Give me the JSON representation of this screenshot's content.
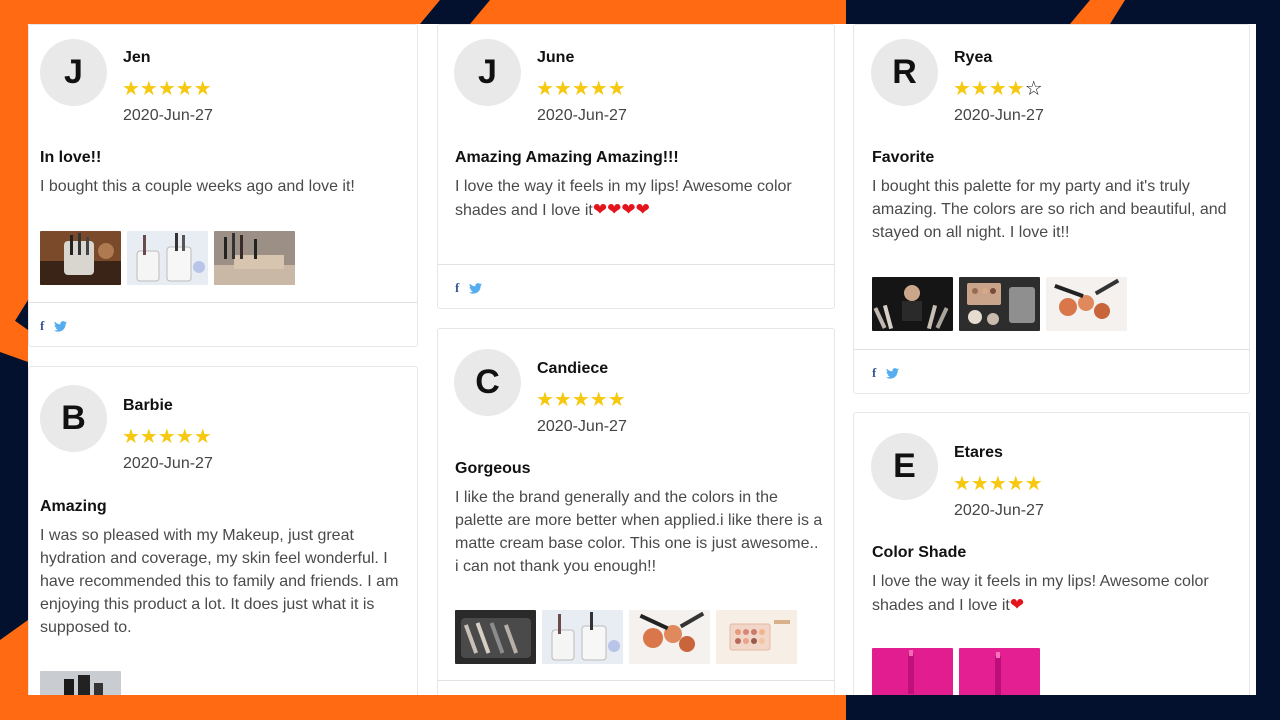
{
  "reviews": [
    {
      "initial": "J",
      "name": "Jen",
      "rating": 5,
      "stars": "★★★★★",
      "date": "2020-Jun-27",
      "title": "In love!!",
      "body": "I bought this a couple weeks ago and love it!"
    },
    {
      "initial": "B",
      "name": "Barbie",
      "rating": 5,
      "stars": "★★★★★",
      "date": "2020-Jun-27",
      "title": "Amazing",
      "body": "I was so pleased with my Makeup, just great hydration and coverage, my skin feel wonderful. I have recommended this to family and friends. I am enjoying this product a lot. It does just what it is supposed to."
    },
    {
      "initial": "J",
      "name": "June",
      "rating": 5,
      "stars": "★★★★★",
      "date": "2020-Jun-27",
      "title": "Amazing Amazing Amazing!!!",
      "body": "I love the way it feels in my lips! Awesome color shades and I love it",
      "hearts": "❤❤❤❤"
    },
    {
      "initial": "C",
      "name": "Candiece",
      "rating": 5,
      "stars": "★★★★★",
      "date": "2020-Jun-27",
      "title": "Gorgeous",
      "body": "I like the brand generally and the colors in the palette are more better when applied.i like there is a matte cream base color. This one is just awesome.. i can not thank you enough!!"
    },
    {
      "initial": "R",
      "name": "Ryea",
      "rating": 4,
      "stars": "★★★★",
      "star_empty": "☆",
      "date": "2020-Jun-27",
      "title": "Favorite",
      "body": "I bought this palette for my party and it's truly amazing. The colors are so rich and beautiful, and stayed on all night. I love it!!"
    },
    {
      "initial": "E",
      "name": "Etares",
      "rating": 5,
      "stars": "★★★★★",
      "date": "2020-Jun-27",
      "title": "Color Shade",
      "body": "I love the way it feels in my lips! Awesome color shades and I love it",
      "hearts": "❤"
    }
  ],
  "share": {
    "facebook_glyph": "f",
    "icons": [
      "facebook-icon",
      "twitter-icon"
    ]
  },
  "colors": {
    "star": "#f6c80f",
    "heart": "#e3141b",
    "facebook": "#3b5998",
    "twitter": "#55acee",
    "bg_orange": "#ff6a13",
    "bg_navy": "#03102e"
  }
}
